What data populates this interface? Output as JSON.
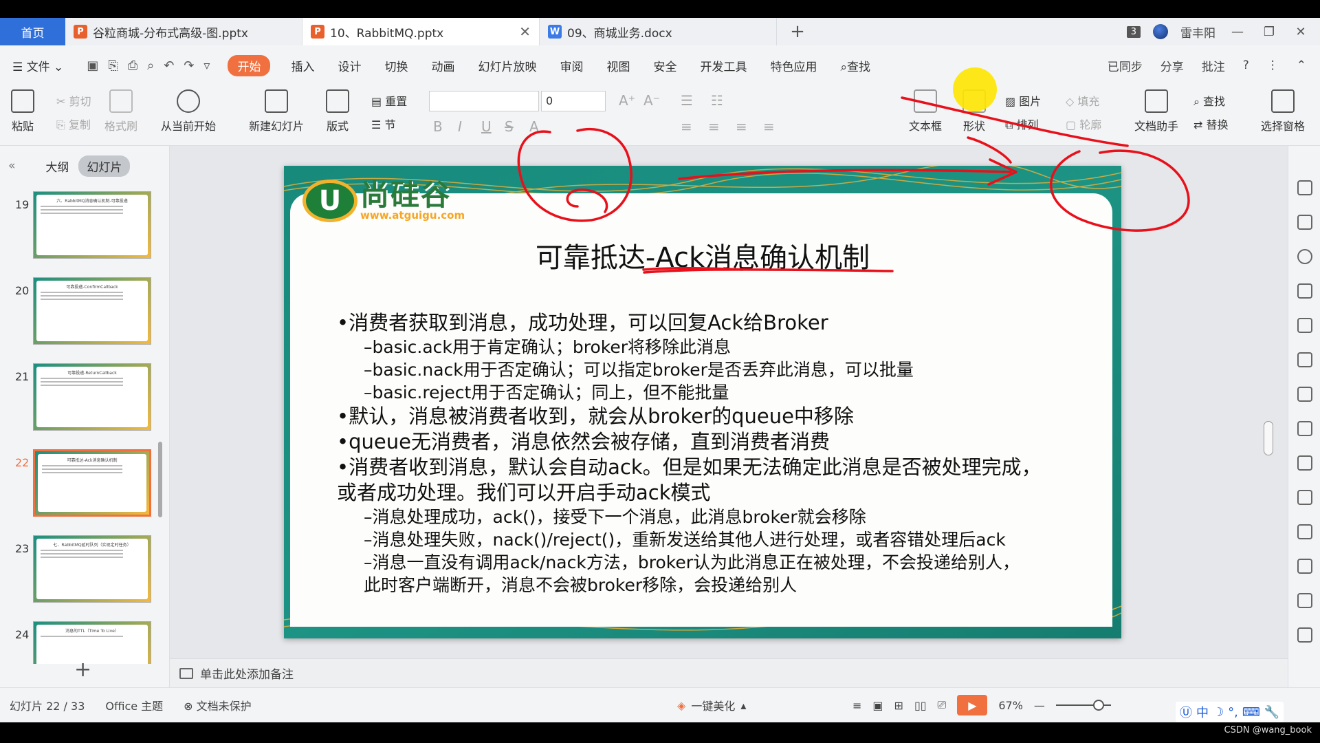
{
  "tabs": {
    "home": "首页",
    "docs": [
      {
        "label": "谷粒商城-分布式高级-图.pptx",
        "type": "ppt"
      },
      {
        "label": "10、RabbitMQ.pptx",
        "type": "ppt"
      },
      {
        "label": "09、商城业务.docx",
        "type": "doc"
      }
    ],
    "window_count": "3",
    "user": "雷丰阳"
  },
  "menu": {
    "file": "文件",
    "items": [
      "开始",
      "插入",
      "设计",
      "切换",
      "动画",
      "幻灯片放映",
      "审阅",
      "视图",
      "安全",
      "开发工具",
      "特色应用"
    ],
    "search": "查找",
    "right": [
      "已同步",
      "分享",
      "批注"
    ]
  },
  "ribbon": {
    "paste": "粘贴",
    "cut": "剪切",
    "copy": "复制",
    "format_painter": "格式刷",
    "from_current": "从当前开始",
    "new_slide": "新建幻灯片",
    "layout": "版式",
    "reset": "重置",
    "section": "节",
    "font_size": "0",
    "textbox": "文本框",
    "shape": "形状",
    "picture": "图片",
    "fill": "填充",
    "arrange": "排列",
    "outline": "轮廓",
    "doc_assistant": "文档助手",
    "find": "查找",
    "replace": "替换",
    "select_pane": "选择窗格"
  },
  "left_panel": {
    "outline_tab": "大纲",
    "slides_tab": "幻灯片",
    "thumbnails": [
      {
        "num": "19",
        "title": "六、RabbitMQ消息确认机制-可靠投递"
      },
      {
        "num": "20",
        "title": "可靠投递-ConfirmCallback"
      },
      {
        "num": "21",
        "title": "可靠投递-ReturnCallback"
      },
      {
        "num": "22",
        "title": "可靠抵达-Ack消息确认机制"
      },
      {
        "num": "23",
        "title": "七、RabbitMQ延时队列（实现定时任务）"
      },
      {
        "num": "24",
        "title": "消息的TTL（Time To Live）"
      }
    ],
    "selected": "22"
  },
  "slide": {
    "logo_text": "尚硅谷",
    "logo_url": "www.atguigu.com",
    "title": "可靠抵达-Ack消息确认机制",
    "lines": [
      {
        "level": 1,
        "text": "•消费者获取到消息，成功处理，可以回复Ack给Broker"
      },
      {
        "level": 2,
        "text": "–basic.ack用于肯定确认；broker将移除此消息"
      },
      {
        "level": 2,
        "text": "–basic.nack用于否定确认；可以指定broker是否丢弃此消息，可以批量"
      },
      {
        "level": 2,
        "text": "–basic.reject用于否定确认；同上，但不能批量"
      },
      {
        "level": 1,
        "text": "•默认，消息被消费者收到，就会从broker的queue中移除"
      },
      {
        "level": 1,
        "text": "•queue无消费者，消息依然会被存储，直到消费者消费"
      },
      {
        "level": 1,
        "text": "•消费者收到消息，默认会自动ack。但是如果无法确定此消息是否被处理完成，"
      },
      {
        "level": 1,
        "text": "或者成功处理。我们可以开启手动ack模式"
      },
      {
        "level": 2,
        "text": "–消息处理成功，ack()，接受下一个消息，此消息broker就会移除"
      },
      {
        "level": 2,
        "text": "–消息处理失败，nack()/reject()，重新发送给其他人进行处理，或者容错处理后ack"
      },
      {
        "level": 2,
        "text": "–消息一直没有调用ack/nack方法，broker认为此消息正在被处理，不会投递给别人，"
      },
      {
        "level": 2,
        "text": "此时客户端断开，消息不会被broker移除，会投递给别人"
      }
    ]
  },
  "notes_placeholder": "单击此处添加备注",
  "status": {
    "slide_info": "幻灯片 22 / 33",
    "theme": "Office 主题",
    "protect": "文档未保护",
    "beautify": "一键美化",
    "zoom": "67%"
  },
  "ime": "中",
  "watermark": "CSDN @wang_book",
  "colors": {
    "accent": "#f07040",
    "home_tab": "#2f6fda",
    "slide_frame": "#1c8b7e",
    "annotation": "#e8101a"
  }
}
